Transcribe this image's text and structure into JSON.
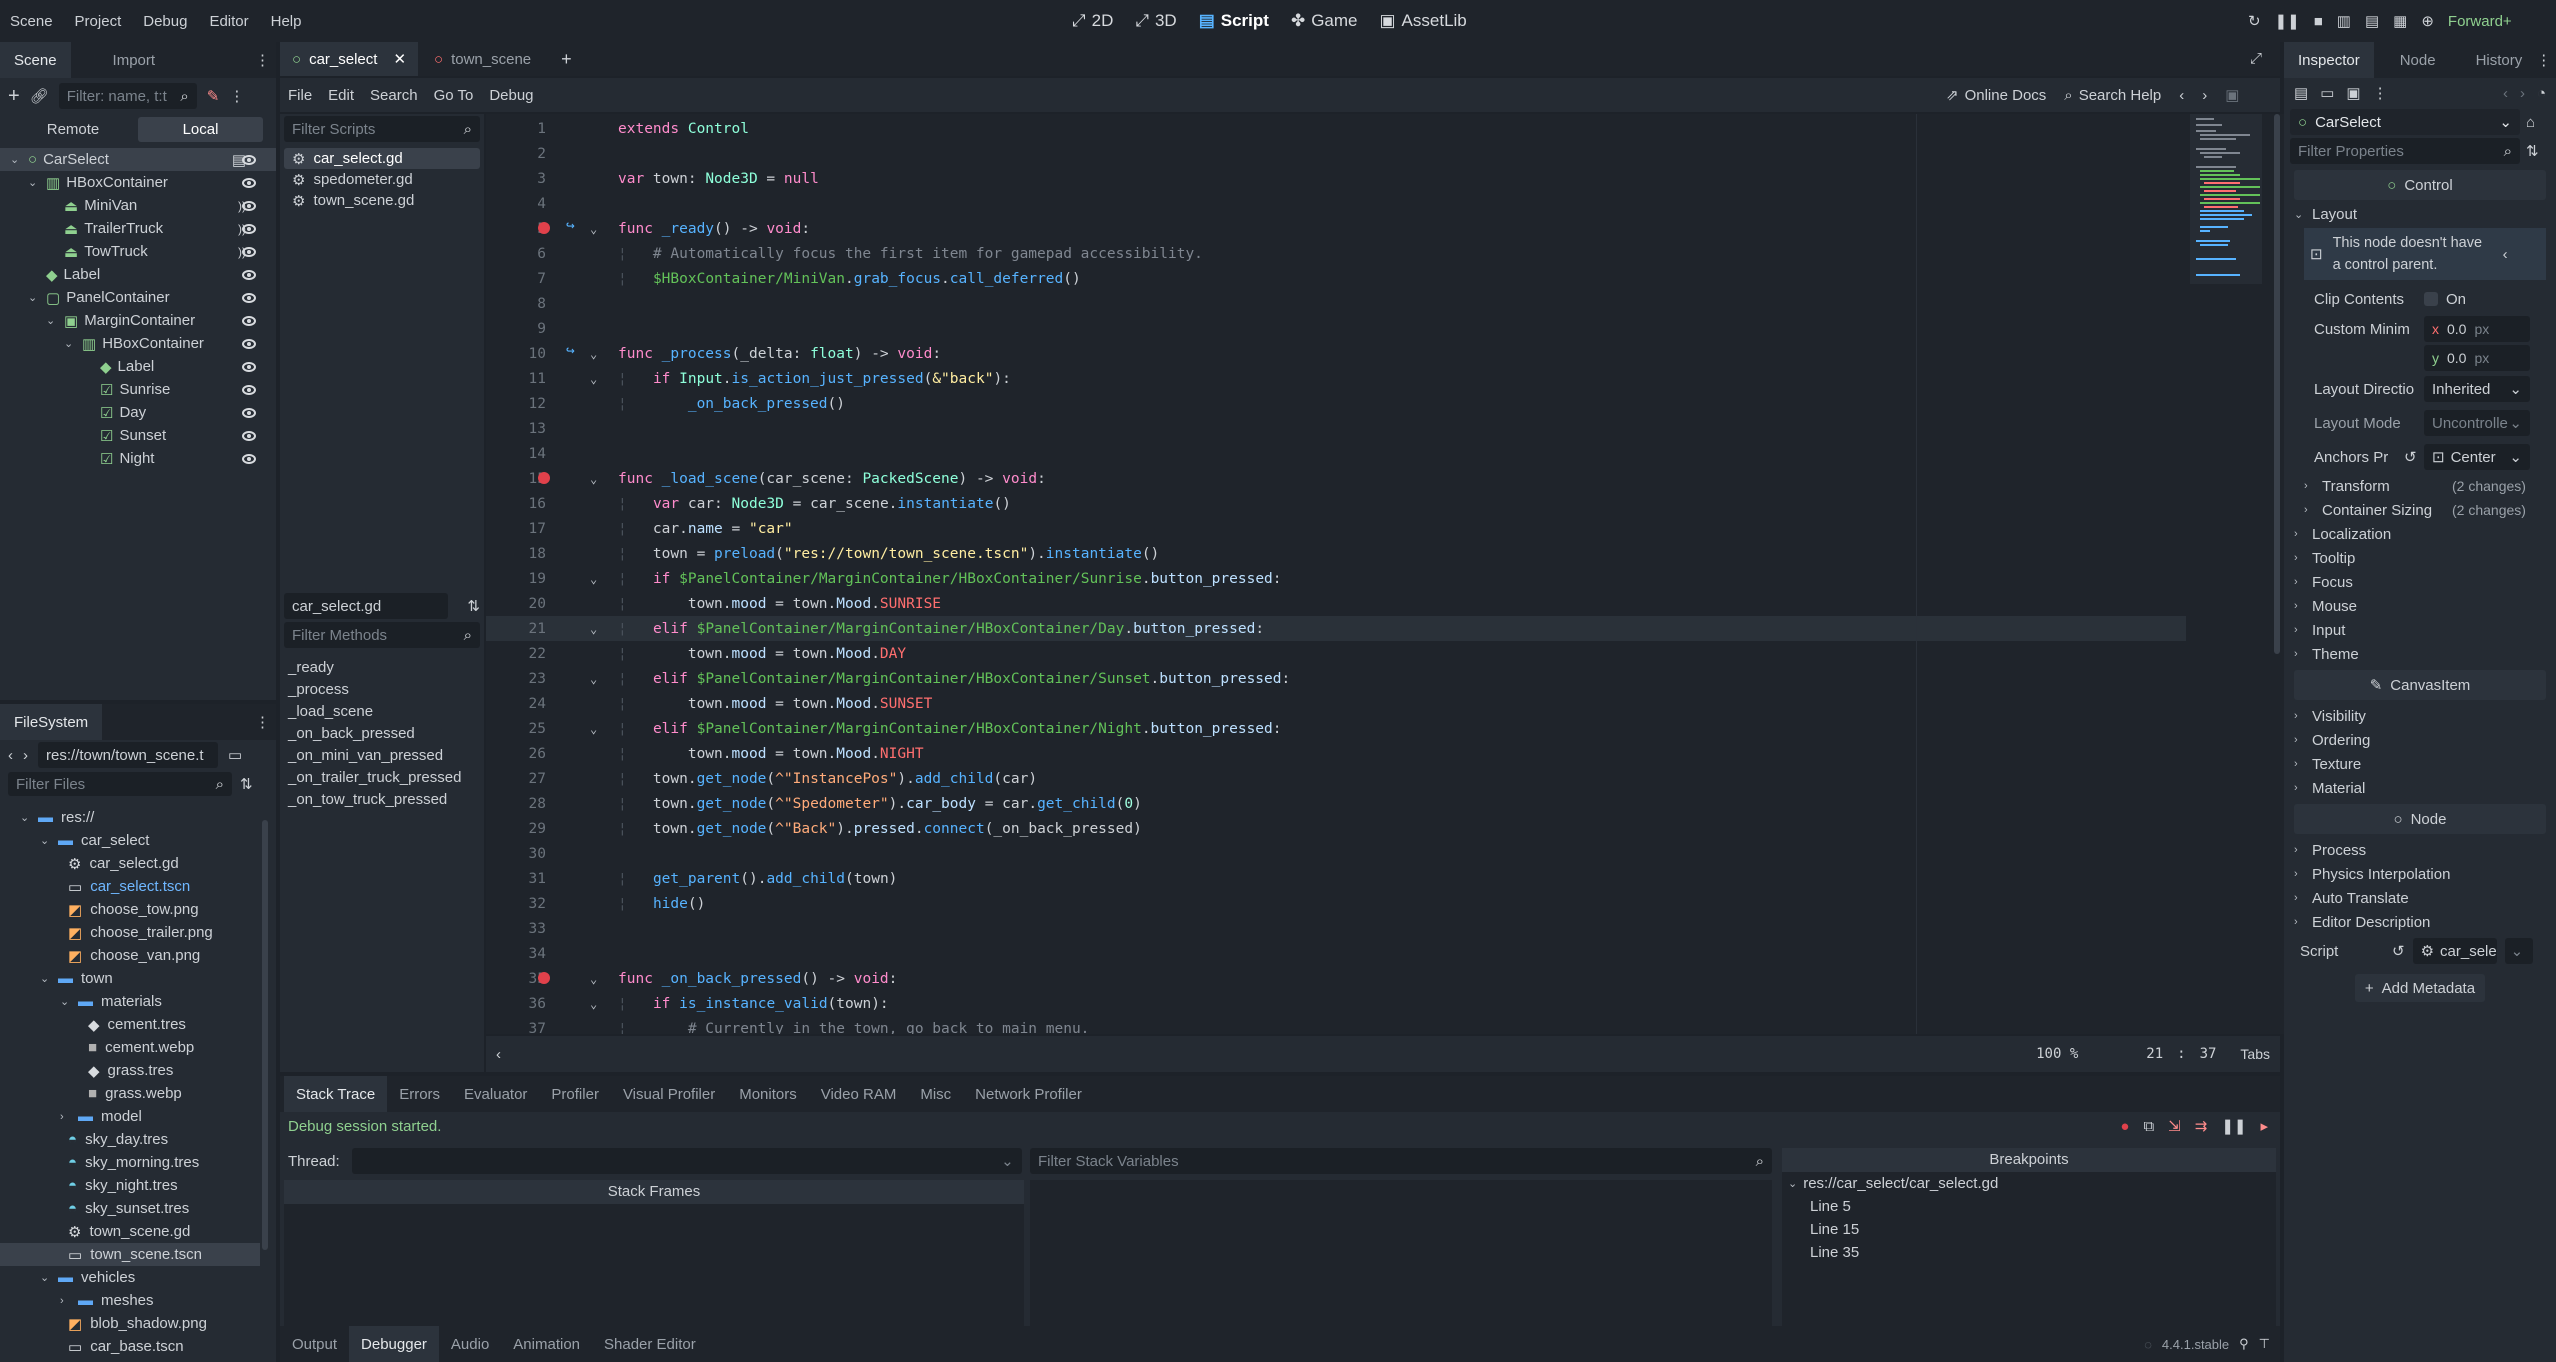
{
  "topbar": {
    "menus": [
      "Scene",
      "Project",
      "Debug",
      "Editor",
      "Help"
    ],
    "workspaces": [
      {
        "label": "2D",
        "icon": "2d-icon"
      },
      {
        "label": "3D",
        "icon": "3d-icon"
      },
      {
        "label": "Script",
        "icon": "script-icon",
        "active": true
      },
      {
        "label": "Game",
        "icon": "game-icon"
      },
      {
        "label": "AssetLib",
        "icon": "assetlib-icon"
      }
    ],
    "renderer": "Forward+"
  },
  "scene_dock": {
    "tabs": [
      "Scene",
      "Import"
    ],
    "filter_placeholder": "Filter: name, t:t",
    "remote": "Remote",
    "local": "Local",
    "tree": [
      {
        "label": "CarSelect",
        "depth": 0,
        "icon": "control-icon",
        "selected": true,
        "script": true
      },
      {
        "label": "HBoxContainer",
        "depth": 1,
        "icon": "hbox-icon"
      },
      {
        "label": "MiniVan",
        "depth": 2,
        "icon": "button-icon",
        "signal": true
      },
      {
        "label": "TrailerTruck",
        "depth": 2,
        "icon": "button-icon",
        "signal": true
      },
      {
        "label": "TowTruck",
        "depth": 2,
        "icon": "button-icon",
        "signal": true
      },
      {
        "label": "Label",
        "depth": 1,
        "icon": "label-icon"
      },
      {
        "label": "PanelContainer",
        "depth": 1,
        "icon": "panel-icon"
      },
      {
        "label": "MarginContainer",
        "depth": 2,
        "icon": "margin-icon"
      },
      {
        "label": "HBoxContainer",
        "depth": 3,
        "icon": "hbox-icon"
      },
      {
        "label": "Label",
        "depth": 4,
        "icon": "label-icon"
      },
      {
        "label": "Sunrise",
        "depth": 4,
        "icon": "check-icon"
      },
      {
        "label": "Day",
        "depth": 4,
        "icon": "check-icon"
      },
      {
        "label": "Sunset",
        "depth": 4,
        "icon": "check-icon"
      },
      {
        "label": "Night",
        "depth": 4,
        "icon": "check-icon"
      }
    ]
  },
  "filesystem": {
    "title": "FileSystem",
    "path": "res://town/town_scene.t",
    "filter_placeholder": "Filter Files",
    "tree": [
      {
        "label": "res://",
        "depth": 0,
        "type": "folder"
      },
      {
        "label": "car_select",
        "depth": 1,
        "type": "folder"
      },
      {
        "label": "car_select.gd",
        "depth": 2,
        "type": "gd"
      },
      {
        "label": "car_select.tscn",
        "depth": 2,
        "type": "tscn",
        "highlight": true
      },
      {
        "label": "choose_tow.png",
        "depth": 2,
        "type": "png"
      },
      {
        "label": "choose_trailer.png",
        "depth": 2,
        "type": "png"
      },
      {
        "label": "choose_van.png",
        "depth": 2,
        "type": "png"
      },
      {
        "label": "town",
        "depth": 1,
        "type": "folder"
      },
      {
        "label": "materials",
        "depth": 2,
        "type": "folder"
      },
      {
        "label": "cement.tres",
        "depth": 3,
        "type": "tres"
      },
      {
        "label": "cement.webp",
        "depth": 3,
        "type": "webp"
      },
      {
        "label": "grass.tres",
        "depth": 3,
        "type": "tres"
      },
      {
        "label": "grass.webp",
        "depth": 3,
        "type": "webp"
      },
      {
        "label": "model",
        "depth": 2,
        "type": "folder"
      },
      {
        "label": "sky_day.tres",
        "depth": 2,
        "type": "sky"
      },
      {
        "label": "sky_morning.tres",
        "depth": 2,
        "type": "sky"
      },
      {
        "label": "sky_night.tres",
        "depth": 2,
        "type": "sky"
      },
      {
        "label": "sky_sunset.tres",
        "depth": 2,
        "type": "sky"
      },
      {
        "label": "town_scene.gd",
        "depth": 2,
        "type": "gd"
      },
      {
        "label": "town_scene.tscn",
        "depth": 2,
        "type": "tscn",
        "selected": true
      },
      {
        "label": "vehicles",
        "depth": 1,
        "type": "folder"
      },
      {
        "label": "meshes",
        "depth": 2,
        "type": "folder"
      },
      {
        "label": "blob_shadow.png",
        "depth": 2,
        "type": "png"
      },
      {
        "label": "car_base.tscn",
        "depth": 2,
        "type": "tscn"
      }
    ]
  },
  "editor_tabs": [
    {
      "label": "car_select",
      "active": true
    },
    {
      "label": "town_scene",
      "active": false
    }
  ],
  "script_menu": [
    "File",
    "Edit",
    "Search",
    "Go To",
    "Debug"
  ],
  "script_links": {
    "online_docs": "Online Docs",
    "search_help": "Search Help"
  },
  "scripts_panel": {
    "filter_placeholder": "Filter Scripts",
    "scripts": [
      "car_select.gd",
      "spedometer.gd",
      "town_scene.gd"
    ],
    "current": "car_select.gd",
    "methods_placeholder": "Filter Methods",
    "methods": [
      "_ready",
      "_process",
      "_load_scene",
      "_on_back_pressed",
      "_on_mini_van_pressed",
      "_on_trailer_truck_pressed",
      "_on_tow_truck_pressed"
    ]
  },
  "code": {
    "zoom": "100 %",
    "cursor_line": "21",
    "cursor_col": "37",
    "indent": "Tabs",
    "lines": [
      {
        "n": "1",
        "h": "<span class='kw'>extends</span> <span class='ty'>Control</span>"
      },
      {
        "n": "2",
        "h": ""
      },
      {
        "n": "3",
        "h": "<span class='kw'>var</span> town: <span class='ty'>Node3D</span> = <span class='kw'>null</span>"
      },
      {
        "n": "4",
        "h": ""
      },
      {
        "n": "5",
        "h": "<span class='kw'>func</span> <span class='fn'>_ready</span>() -> <span class='kw'>void</span>:",
        "bp": true,
        "ret": true,
        "fold": true
      },
      {
        "n": "6",
        "h": "<span class='cm'>    # Automatically focus the first item for gamepad accessibility.</span>",
        "tab": true
      },
      {
        "n": "7",
        "h": "    <span class='nd'>$HBoxContainer/MiniVan</span>.<span class='fn'>grab_focus</span>.<span class='fn'>call_deferred</span>()",
        "tab": true
      },
      {
        "n": "8",
        "h": ""
      },
      {
        "n": "9",
        "h": ""
      },
      {
        "n": "10",
        "h": "<span class='kw'>func</span> <span class='fn'>_process</span>(_delta: <span class='ty'>float</span>) -> <span class='kw'>void</span>:",
        "ret": true,
        "fold": true
      },
      {
        "n": "11",
        "h": "    <span class='kw'>if</span> <span class='ty'>Input</span>.<span class='fn'>is_action_just_pressed</span>(<span class='str'>&amp;\"back\"</span>):",
        "tab": true,
        "fold": true
      },
      {
        "n": "12",
        "h": "        <span class='fn'>_on_back_pressed</span>()",
        "tab": true
      },
      {
        "n": "13",
        "h": ""
      },
      {
        "n": "14",
        "h": ""
      },
      {
        "n": "15",
        "h": "<span class='kw'>func</span> <span class='fn'>_load_scene</span>(car_scene: <span class='ty'>PackedScene</span>) -> <span class='kw'>void</span>:",
        "bp": true,
        "fold": true
      },
      {
        "n": "16",
        "h": "    <span class='kw'>var</span> car: <span class='ty'>Node3D</span> = car_scene.<span class='fn'>instantiate</span>()",
        "tab": true
      },
      {
        "n": "17",
        "h": "    car.<span class='mem'>name</span> = <span class='str'>\"car\"</span>",
        "tab": true
      },
      {
        "n": "18",
        "h": "    town = <span class='fn'>preload</span>(<span class='str'>\"res://town/town_scene.tscn\"</span>).<span class='fn'>instantiate</span>()",
        "tab": true
      },
      {
        "n": "19",
        "h": "    <span class='kw'>if</span> <span class='nd'>$PanelContainer/MarginContainer/HBoxContainer/Sunrise</span>.<span class='mem'>button_pressed</span>:",
        "tab": true,
        "fold": true
      },
      {
        "n": "20",
        "h": "        town.<span class='mem'>mood</span> = town.<span class='mem'>Mood</span>.<span class='cn'>SUNRISE</span>",
        "tab": true
      },
      {
        "n": "21",
        "h": "    <span class='kw'>elif</span> <span class='nd'>$PanelContainer/MarginContainer/HBoxContainer/Day</span>.<span class='mem'>button_pressed</span>:",
        "tab": true,
        "fold": true,
        "current": true
      },
      {
        "n": "22",
        "h": "        town.<span class='mem'>mood</span> = town.<span class='mem'>Mood</span>.<span class='cn'>DAY</span>",
        "tab": true
      },
      {
        "n": "23",
        "h": "    <span class='kw'>elif</span> <span class='nd'>$PanelContainer/MarginContainer/HBoxContainer/Sunset</span>.<span class='mem'>button_pressed</span>:",
        "tab": true,
        "fold": true
      },
      {
        "n": "24",
        "h": "        town.<span class='mem'>mood</span> = town.<span class='mem'>Mood</span>.<span class='cn'>SUNSET</span>",
        "tab": true
      },
      {
        "n": "25",
        "h": "    <span class='kw'>elif</span> <span class='nd'>$PanelContainer/MarginContainer/HBoxContainer/Night</span>.<span class='mem'>button_pressed</span>:",
        "tab": true,
        "fold": true
      },
      {
        "n": "26",
        "h": "        town.<span class='mem'>mood</span> = town.<span class='mem'>Mood</span>.<span class='cn'>NIGHT</span>",
        "tab": true
      },
      {
        "n": "27",
        "h": "    town.<span class='fn'>get_node</span>(<span class='snm'>^\"InstancePos\"</span>).<span class='fn'>add_child</span>(car)",
        "tab": true
      },
      {
        "n": "28",
        "h": "    town.<span class='fn'>get_node</span>(<span class='snm'>^\"Spedometer\"</span>).<span class='mem'>car_body</span> = car.<span class='fn'>get_child</span>(<span class='num'>0</span>)",
        "tab": true
      },
      {
        "n": "29",
        "h": "    town.<span class='fn'>get_node</span>(<span class='snm'>^\"Back\"</span>).<span class='mem'>pressed</span>.<span class='fn'>connect</span>(_on_back_pressed)",
        "tab": true
      },
      {
        "n": "30",
        "h": ""
      },
      {
        "n": "31",
        "h": "    <span class='fn'>get_parent</span>().<span class='fn'>add_child</span>(town)",
        "tab": true
      },
      {
        "n": "32",
        "h": "    <span class='fn'>hide</span>()",
        "tab": true
      },
      {
        "n": "33",
        "h": ""
      },
      {
        "n": "34",
        "h": ""
      },
      {
        "n": "35",
        "h": "<span class='kw'>func</span> <span class='fn'>_on_back_pressed</span>() -> <span class='kw'>void</span>:",
        "bp": true,
        "fold": true
      },
      {
        "n": "36",
        "h": "    <span class='kw'>if</span> <span class='fn'>is_instance_valid</span>(town):",
        "tab": true,
        "fold": true
      },
      {
        "n": "37",
        "h": "<span class='cm'>        # Currently in the town, go back to main menu.</span>",
        "tab": true
      }
    ]
  },
  "bottom": {
    "debug_tabs": [
      "Stack Trace",
      "Errors",
      "Evaluator",
      "Profiler",
      "Visual Profiler",
      "Monitors",
      "Video RAM",
      "Misc",
      "Network Profiler"
    ],
    "status": "Debug session started.",
    "thread_label": "Thread:",
    "stack_frames": "Stack Frames",
    "filter_vars_placeholder": "Filter Stack Variables",
    "breakpoints_title": "Breakpoints",
    "bp_file": "res://car_select/car_select.gd",
    "bp_lines": [
      "Line 5",
      "Line 15",
      "Line 35"
    ],
    "panel_tabs": [
      "Output",
      "Debugger",
      "Audio",
      "Animation",
      "Shader Editor"
    ],
    "version": "4.4.1.stable"
  },
  "inspector": {
    "tabs": [
      "Inspector",
      "Node",
      "History"
    ],
    "node_name": "CarSelect",
    "filter_placeholder": "Filter Properties",
    "class_control": "Control",
    "layout": "Layout",
    "warning": "This node doesn't have a control parent.",
    "clip_contents": "Clip Contents",
    "on": "On",
    "custom_min": "Custom Minim",
    "x": "x",
    "y": "y",
    "xval": "0.0",
    "yval": "0.0",
    "px": "px",
    "layout_dir": "Layout Directio",
    "layout_dir_val": "Inherited",
    "layout_mode": "Layout Mode",
    "layout_mode_val": "Uncontrolle",
    "anchors": "Anchors Pr",
    "anchors_val": "Center",
    "transform": "Transform",
    "container_sizing": "Container Sizing",
    "changes": "(2 changes)",
    "groups1": [
      "Localization",
      "Tooltip",
      "Focus",
      "Mouse",
      "Input",
      "Theme"
    ],
    "class_canvas": "CanvasItem",
    "groups2": [
      "Visibility",
      "Ordering",
      "Texture",
      "Material"
    ],
    "class_node": "Node",
    "groups3": [
      "Process",
      "Physics Interpolation",
      "Auto Translate",
      "Editor Description"
    ],
    "script_label": "Script",
    "script_val": "car_sele",
    "add_metadata": "Add Metadata"
  }
}
